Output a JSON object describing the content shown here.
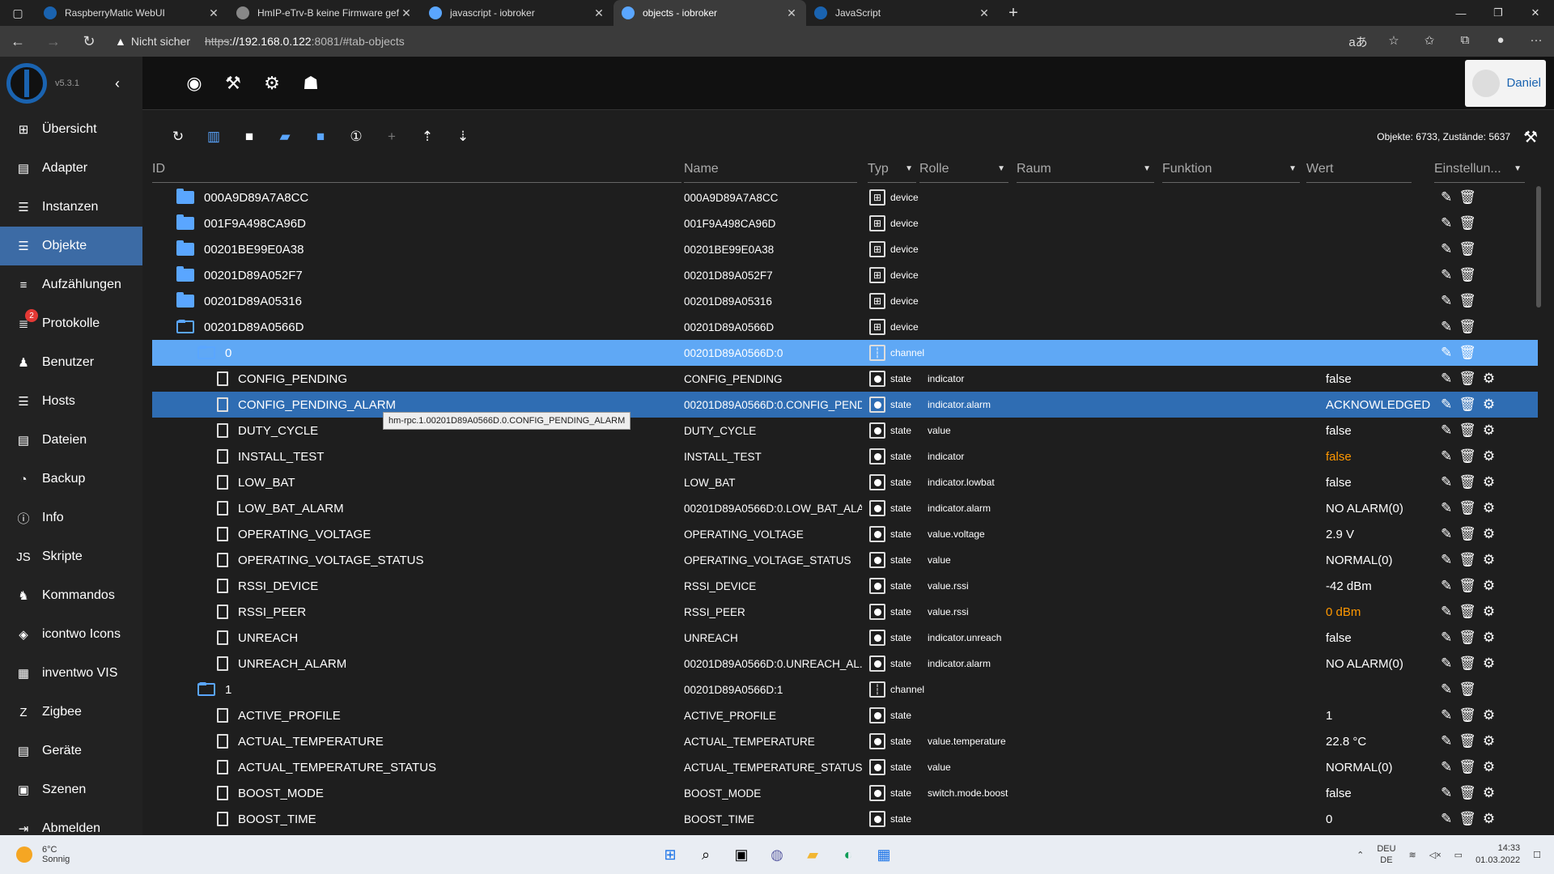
{
  "browser": {
    "tabs": [
      {
        "title": "RaspberryMatic WebUI",
        "color": "#1a63b0"
      },
      {
        "title": "HmIP-eTrv-B keine Firmware gef",
        "color": "#888888"
      },
      {
        "title": "javascript - iobroker",
        "color": "#5aa6ff"
      },
      {
        "title": "objects - iobroker",
        "color": "#5aa6ff"
      },
      {
        "title": "JavaScript",
        "color": "#1a63b0"
      }
    ],
    "security_warning": "Nicht sicher",
    "url_scheme": "https",
    "url_host": "://192.168.0.122",
    "url_rest": ":8081/#tab-objects"
  },
  "sidebar": {
    "version": "v5.3.1",
    "items": [
      {
        "label": "Übersicht",
        "icon": "grid-icon"
      },
      {
        "label": "Adapter",
        "icon": "store-icon"
      },
      {
        "label": "Instanzen",
        "icon": "instances-icon"
      },
      {
        "label": "Objekte",
        "icon": "list-icon"
      },
      {
        "label": "Aufzählungen",
        "icon": "enum-icon"
      },
      {
        "label": "Protokolle",
        "icon": "log-icon",
        "badge": "2"
      },
      {
        "label": "Benutzer",
        "icon": "user-icon"
      },
      {
        "label": "Hosts",
        "icon": "hosts-icon"
      },
      {
        "label": "Dateien",
        "icon": "files-icon"
      },
      {
        "label": "Backup",
        "icon": "backup-icon"
      },
      {
        "label": "Info",
        "icon": "info-icon"
      },
      {
        "label": "Skripte",
        "icon": "scripts-icon"
      },
      {
        "label": "Kommandos",
        "icon": "commands-icon"
      },
      {
        "label": "icontwo Icons",
        "icon": "icontwo-icon"
      },
      {
        "label": "inventwo VIS",
        "icon": "inventwo-icon"
      },
      {
        "label": "Zigbee",
        "icon": "zigbee-icon"
      },
      {
        "label": "Geräte",
        "icon": "devices-icon"
      },
      {
        "label": "Szenen",
        "icon": "scenes-icon"
      },
      {
        "label": "Abmelden",
        "icon": "logout-icon"
      }
    ]
  },
  "topbar": {
    "user": "Daniel"
  },
  "toolbar": {
    "counts": "Objekte: 6733, Zustände: 5637"
  },
  "columns": {
    "id": "ID",
    "name": "Name",
    "type": "Typ",
    "role": "Rolle",
    "room": "Raum",
    "function": "Funktion",
    "value": "Wert",
    "settings": "Einstellun..."
  },
  "tooltip": "hm-rpc.1.00201D89A0566D.0.CONFIG_PENDING_ALARM",
  "rows": [
    {
      "id": "000A9D89A7A8CC",
      "name": "000A9D89A7A8CC",
      "type": "device",
      "role": "",
      "value": "",
      "kind": "folder",
      "level": 0
    },
    {
      "id": "001F9A498CA96D",
      "name": "001F9A498CA96D",
      "type": "device",
      "role": "",
      "value": "",
      "kind": "folder",
      "level": 0
    },
    {
      "id": "00201BE99E0A38",
      "name": "00201BE99E0A38",
      "type": "device",
      "role": "",
      "value": "",
      "kind": "folder",
      "level": 0
    },
    {
      "id": "00201D89A052F7",
      "name": "00201D89A052F7",
      "type": "device",
      "role": "",
      "value": "",
      "kind": "folder",
      "level": 0
    },
    {
      "id": "00201D89A05316",
      "name": "00201D89A05316",
      "type": "device",
      "role": "",
      "value": "",
      "kind": "folder",
      "level": 0
    },
    {
      "id": "00201D89A0566D",
      "name": "00201D89A0566D",
      "type": "device",
      "role": "",
      "value": "",
      "kind": "folder-open",
      "level": 0
    },
    {
      "id": "0",
      "name": "00201D89A0566D:0",
      "type": "channel",
      "role": "",
      "value": "",
      "kind": "folder-open",
      "level": 1,
      "sel": "light"
    },
    {
      "id": "CONFIG_PENDING",
      "name": "CONFIG_PENDING",
      "type": "state",
      "role": "indicator",
      "value": "false",
      "kind": "file",
      "level": 2
    },
    {
      "id": "CONFIG_PENDING_ALARM",
      "name": "00201D89A0566D:0.CONFIG_PEND...",
      "type": "state",
      "role": "indicator.alarm",
      "value": "ACKNOWLEDGED...",
      "kind": "file",
      "level": 2,
      "sel": "dark"
    },
    {
      "id": "DUTY_CYCLE",
      "name": "DUTY_CYCLE",
      "type": "state",
      "role": "value",
      "value": "false",
      "kind": "file",
      "level": 2
    },
    {
      "id": "INSTALL_TEST",
      "name": "INSTALL_TEST",
      "type": "state",
      "role": "indicator",
      "value": "false",
      "kind": "file",
      "level": 2,
      "warn": true
    },
    {
      "id": "LOW_BAT",
      "name": "LOW_BAT",
      "type": "state",
      "role": "indicator.lowbat",
      "value": "false",
      "kind": "file",
      "level": 2
    },
    {
      "id": "LOW_BAT_ALARM",
      "name": "00201D89A0566D:0.LOW_BAT_ALA...",
      "type": "state",
      "role": "indicator.alarm",
      "value": "NO ALARM(0)",
      "kind": "file",
      "level": 2
    },
    {
      "id": "OPERATING_VOLTAGE",
      "name": "OPERATING_VOLTAGE",
      "type": "state",
      "role": "value.voltage",
      "value": "2.9 V",
      "kind": "file",
      "level": 2
    },
    {
      "id": "OPERATING_VOLTAGE_STATUS",
      "name": "OPERATING_VOLTAGE_STATUS",
      "type": "state",
      "role": "value",
      "value": "NORMAL(0)",
      "kind": "file",
      "level": 2
    },
    {
      "id": "RSSI_DEVICE",
      "name": "RSSI_DEVICE",
      "type": "state",
      "role": "value.rssi",
      "value": "-42 dBm",
      "kind": "file",
      "level": 2
    },
    {
      "id": "RSSI_PEER",
      "name": "RSSI_PEER",
      "type": "state",
      "role": "value.rssi",
      "value": "0 dBm",
      "kind": "file",
      "level": 2,
      "warn": true
    },
    {
      "id": "UNREACH",
      "name": "UNREACH",
      "type": "state",
      "role": "indicator.unreach",
      "value": "false",
      "kind": "file",
      "level": 2
    },
    {
      "id": "UNREACH_ALARM",
      "name": "00201D89A0566D:0.UNREACH_AL...",
      "type": "state",
      "role": "indicator.alarm",
      "value": "NO ALARM(0)",
      "kind": "file",
      "level": 2
    },
    {
      "id": "1",
      "name": "00201D89A0566D:1",
      "type": "channel",
      "role": "",
      "value": "",
      "kind": "folder-open",
      "level": 1
    },
    {
      "id": "ACTIVE_PROFILE",
      "name": "ACTIVE_PROFILE",
      "type": "state",
      "role": "",
      "value": "1",
      "kind": "file",
      "level": 2
    },
    {
      "id": "ACTUAL_TEMPERATURE",
      "name": "ACTUAL_TEMPERATURE",
      "type": "state",
      "role": "value.temperature",
      "value": "22.8 °C",
      "kind": "file",
      "level": 2
    },
    {
      "id": "ACTUAL_TEMPERATURE_STATUS",
      "name": "ACTUAL_TEMPERATURE_STATUS",
      "type": "state",
      "role": "value",
      "value": "NORMAL(0)",
      "kind": "file",
      "level": 2
    },
    {
      "id": "BOOST_MODE",
      "name": "BOOST_MODE",
      "type": "state",
      "role": "switch.mode.boost",
      "value": "false",
      "kind": "file",
      "level": 2
    },
    {
      "id": "BOOST_TIME",
      "name": "BOOST_TIME",
      "type": "state",
      "role": "",
      "value": "0",
      "kind": "file",
      "level": 2
    }
  ],
  "taskbar": {
    "temp": "6°C",
    "weather": "Sonnig",
    "lang1": "DEU",
    "lang2": "DE",
    "time": "14:33",
    "date": "01.03.2022"
  }
}
